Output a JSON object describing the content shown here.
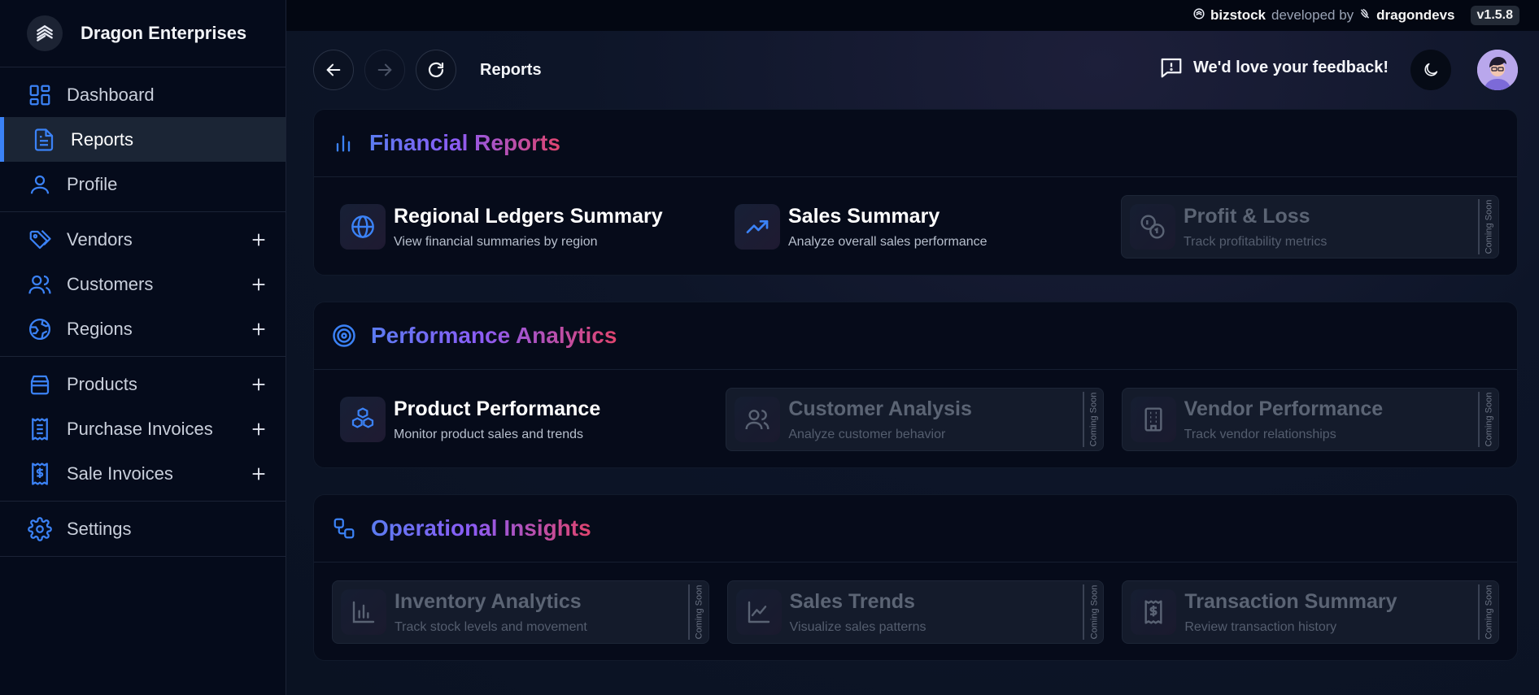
{
  "app": {
    "company_name": "Dragon Enterprises"
  },
  "topbar": {
    "product": "bizstock",
    "developed_by": "developed by",
    "developer": "dragondevs",
    "version": "v1.5.8"
  },
  "sidebar": {
    "groups": [
      [
        {
          "label": "Dashboard",
          "icon": "dashboard-icon"
        },
        {
          "label": "Reports",
          "icon": "document-icon",
          "active": true
        },
        {
          "label": "Profile",
          "icon": "user-icon"
        }
      ],
      [
        {
          "label": "Vendors",
          "icon": "tag-icon",
          "expandable": true
        },
        {
          "label": "Customers",
          "icon": "users-icon",
          "expandable": true
        },
        {
          "label": "Regions",
          "icon": "globe-icon",
          "expandable": true
        }
      ],
      [
        {
          "label": "Products",
          "icon": "box-icon",
          "expandable": true
        },
        {
          "label": "Purchase Invoices",
          "icon": "receipt-icon",
          "expandable": true
        },
        {
          "label": "Sale Invoices",
          "icon": "dollar-receipt-icon",
          "expandable": true
        }
      ],
      [
        {
          "label": "Settings",
          "icon": "gear-icon"
        }
      ]
    ]
  },
  "header": {
    "breadcrumb": "Reports",
    "feedback": "We'd love your feedback!"
  },
  "sections": [
    {
      "title": "Financial Reports",
      "icon": "bar-chart-icon",
      "cards": [
        {
          "title": "Regional Ledgers Summary",
          "desc": "View financial summaries by region",
          "icon": "globe-icon",
          "coming_soon": false
        },
        {
          "title": "Sales Summary",
          "desc": "Analyze overall sales performance",
          "icon": "trending-up-icon",
          "coming_soon": false
        },
        {
          "title": "Profit & Loss",
          "desc": "Track profitability metrics",
          "icon": "coins-icon",
          "coming_soon": true
        }
      ]
    },
    {
      "title": "Performance Analytics",
      "icon": "target-icon",
      "cards": [
        {
          "title": "Product Performance",
          "desc": "Monitor product sales and trends",
          "icon": "boxes-icon",
          "coming_soon": false
        },
        {
          "title": "Customer Analysis",
          "desc": "Analyze customer behavior",
          "icon": "users-icon",
          "coming_soon": true
        },
        {
          "title": "Vendor Performance",
          "desc": "Track vendor relationships",
          "icon": "building-icon",
          "coming_soon": true
        }
      ]
    },
    {
      "title": "Operational Insights",
      "icon": "workflow-icon",
      "cards": [
        {
          "title": "Inventory Analytics",
          "desc": "Track stock levels and movement",
          "icon": "bar-chart-icon",
          "coming_soon": true
        },
        {
          "title": "Sales Trends",
          "desc": "Visualize sales patterns",
          "icon": "line-chart-icon",
          "coming_soon": true
        },
        {
          "title": "Transaction Summary",
          "desc": "Review transaction history",
          "icon": "dollar-receipt-icon",
          "coming_soon": true
        }
      ]
    }
  ],
  "coming_soon_label": "Coming Soon",
  "colors": {
    "accent": "#3b82f6",
    "title_gradient_start": "#5b7cf2",
    "title_gradient_end": "#e0446e"
  }
}
